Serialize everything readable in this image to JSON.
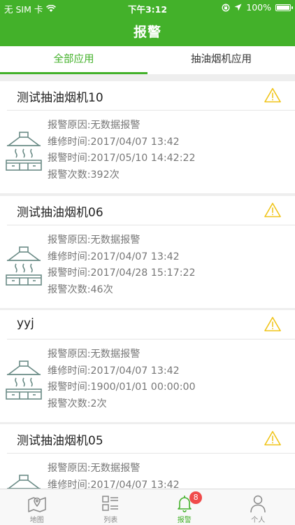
{
  "status_bar": {
    "carrier": "无 SIM 卡",
    "time": "下午3:12",
    "battery": "100%"
  },
  "title": "报警",
  "tabs": [
    {
      "label": "全部应用",
      "active": true
    },
    {
      "label": "抽油烟机应用",
      "active": false
    }
  ],
  "colors": {
    "accent": "#43b12a",
    "warning": "#f0c419",
    "badge": "#f04b4b"
  },
  "alarms": [
    {
      "name": "测试抽油烟机10",
      "reason": "报警原因:无数据报警",
      "maint_time": "维修时间:2017/04/07 13:42",
      "alarm_time": "报警时间:2017/05/10 14:42:22",
      "count": "报警次数:392次"
    },
    {
      "name": "测试抽油烟机06",
      "reason": "报警原因:无数据报警",
      "maint_time": "维修时间:2017/04/07 13:42",
      "alarm_time": "报警时间:2017/04/28 15:17:22",
      "count": "报警次数:46次"
    },
    {
      "name": "yyj",
      "reason": "报警原因:无数据报警",
      "maint_time": "维修时间:2017/04/07 13:42",
      "alarm_time": "报警时间:1900/01/01 00:00:00",
      "count": "报警次数:2次"
    },
    {
      "name": "测试抽油烟机05",
      "reason": "报警原因:无数据报警",
      "maint_time": "维修时间:2017/04/07 13:42",
      "alarm_time": "",
      "count": ""
    }
  ],
  "tabbar": [
    {
      "label": "地图",
      "icon": "map-icon",
      "active": false
    },
    {
      "label": "列表",
      "icon": "list-icon",
      "active": false
    },
    {
      "label": "报警",
      "icon": "bell-icon",
      "active": true,
      "badge": "8"
    },
    {
      "label": "个人",
      "icon": "person-icon",
      "active": false
    }
  ]
}
